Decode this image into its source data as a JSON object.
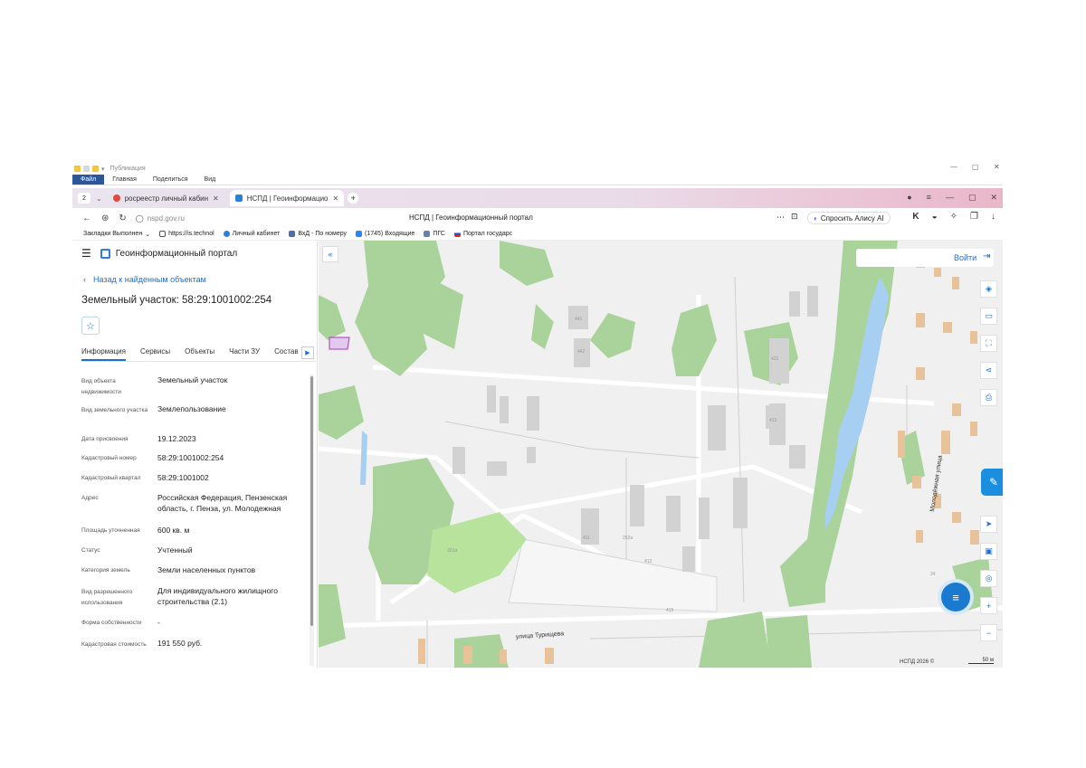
{
  "office": {
    "doc_title": "Публикация",
    "tabs": [
      "Файл",
      "Главная",
      "Поделиться",
      "Вид"
    ],
    "win_min": "—",
    "win_max": "▢",
    "win_close": "✕"
  },
  "browser": {
    "tab_count": "2",
    "tabs": [
      {
        "label": "росреестр личный кабин",
        "close": "✕"
      },
      {
        "label": "НСПД | Геоинформацио",
        "close": "✕"
      }
    ],
    "new_tab": "+",
    "url": "nspd.gov.ru",
    "page_title": "НСПД | Геоинформационный портал",
    "alice": "Спросить Алису AI",
    "bookmarks": [
      "Закладки Выполнен",
      "https://is.technol",
      "Личный кабинет",
      "ВхД - По номеру",
      "(1745) Входящие",
      "ПГС",
      "Портал государс"
    ]
  },
  "portal": {
    "name": "Геоинформационный портал",
    "back_link": "Назад к найденным объектам",
    "object_title": "Земельный участок: 58:29:1001002:254",
    "tabs": [
      "Информация",
      "Сервисы",
      "Объекты",
      "Части ЗУ",
      "Состав"
    ],
    "info_rows": [
      {
        "label": "Вид объекта недвижимости",
        "value": "Земельный участок"
      },
      {
        "label": "Вид земельного участка",
        "value": "Землепользование"
      },
      {
        "label": "Дата присвоения",
        "value": "19.12.2023"
      },
      {
        "label": "Кадастровый номер",
        "value": "58:29:1001002:254"
      },
      {
        "label": "Кадастровый квартал",
        "value": "58:29:1001002"
      },
      {
        "label": "Адрес",
        "value": "Российская Федерация, Пензенская область, г. Пенза, ул. Молодежная"
      },
      {
        "label": "Площадь уточненная",
        "value": "600 кв. м"
      },
      {
        "label": "Статус",
        "value": "Учтенный"
      },
      {
        "label": "Категория земель",
        "value": "Земли населенных пунктов"
      },
      {
        "label": "Вид разрешенного использования",
        "value": "Для индивидуального жилищного строительства (2.1)"
      },
      {
        "label": "Форма собственности",
        "value": "-"
      },
      {
        "label": "Кадастровая стоимость",
        "value": "191 550 руб."
      }
    ]
  },
  "map": {
    "login": "Войти",
    "street_turisheva": "улица Турищева",
    "street_molodezhnaya": "Молодёжная улица",
    "copyright": "НСПД 2026 ©",
    "scale": "50 м",
    "building_numbers": [
      "441",
      "442",
      "421",
      "413",
      "411",
      "412",
      "415",
      "252a",
      "323a",
      "24"
    ],
    "colors": {
      "forest": "#a9d39a",
      "water": "#a6cff2",
      "building": "#d2d2d2",
      "house": "#e8c39a",
      "accent": "#1a6fd6"
    }
  }
}
